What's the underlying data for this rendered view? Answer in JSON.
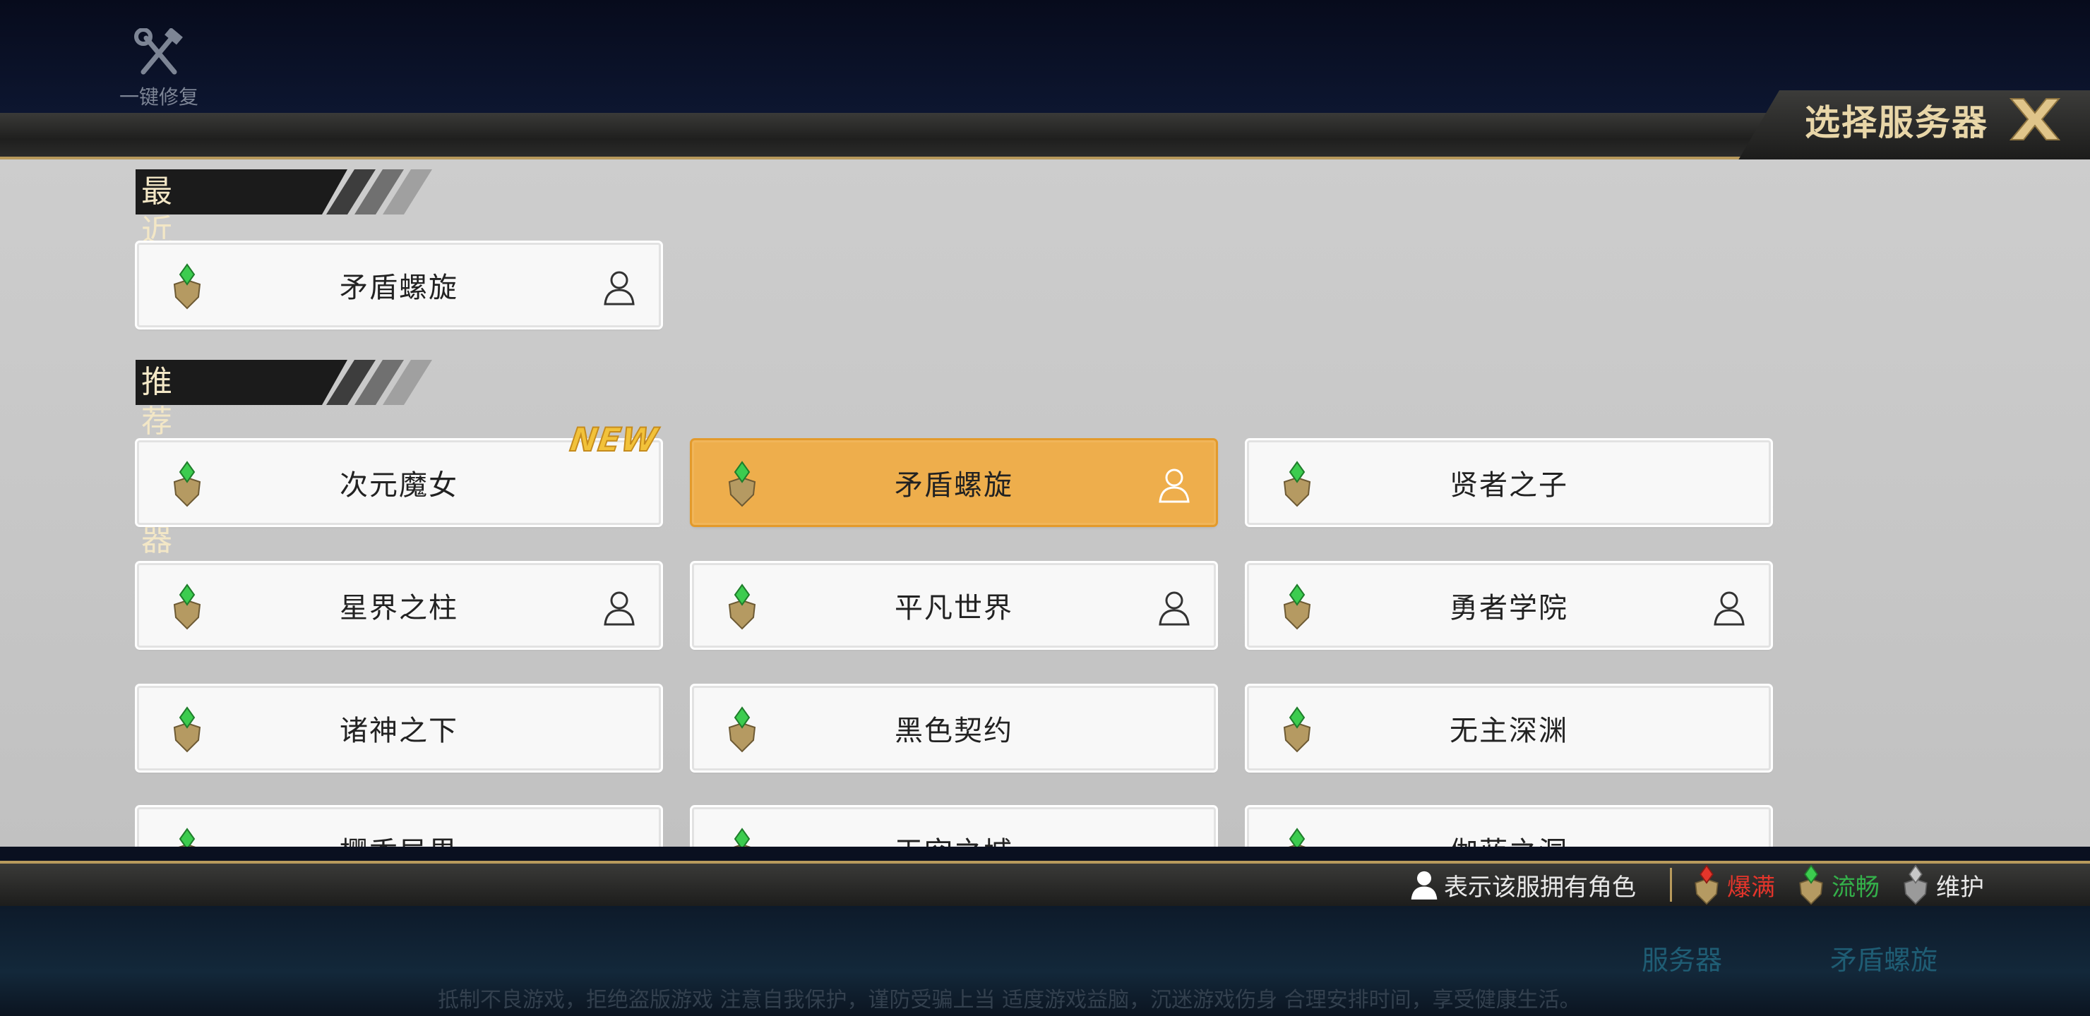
{
  "top": {
    "repair_label": "一键修复"
  },
  "header": {
    "title": "选择服务器"
  },
  "sections": {
    "recent_title": "最近登录",
    "recommended_title": "推荐服务器"
  },
  "recent": [
    {
      "name": "矛盾螺旋",
      "status": "smooth",
      "has_role": true
    }
  ],
  "servers": [
    {
      "name": "次元魔女",
      "status": "smooth",
      "has_role": false,
      "badge": "NEW"
    },
    {
      "name": "矛盾螺旋",
      "status": "smooth",
      "has_role": true,
      "selected": true
    },
    {
      "name": "贤者之子",
      "status": "smooth",
      "has_role": false
    },
    {
      "name": "星界之柱",
      "status": "smooth",
      "has_role": true
    },
    {
      "name": "平凡世界",
      "status": "smooth",
      "has_role": true
    },
    {
      "name": "勇者学院",
      "status": "smooth",
      "has_role": true
    },
    {
      "name": "诸神之下",
      "status": "smooth",
      "has_role": false
    },
    {
      "name": "黑色契约",
      "status": "smooth",
      "has_role": false
    },
    {
      "name": "无主深渊",
      "status": "smooth",
      "has_role": false
    },
    {
      "name": "樱香异界",
      "status": "smooth",
      "has_role": false
    },
    {
      "name": "天空之城",
      "status": "smooth",
      "has_role": false
    },
    {
      "name": "伽蓝之洞",
      "status": "smooth",
      "has_role": false
    }
  ],
  "legend": {
    "role_text": "表示该服拥有角色",
    "full_text": "爆满",
    "smooth_text": "流畅",
    "maintenance_text": "维护"
  },
  "colors": {
    "gold": "#b89a5c",
    "selected": "#eeae4c",
    "full": "#e3352b",
    "smooth": "#34b04a"
  },
  "footer": {
    "server_label": "服务器",
    "server_value": "矛盾螺旋",
    "notice": "抵制不良游戏，拒绝盗版游戏 注意自我保护，谨防受骗上当 适度游戏益脑，沉迷游戏伤身 合理安排时间，享受健康生活。"
  }
}
